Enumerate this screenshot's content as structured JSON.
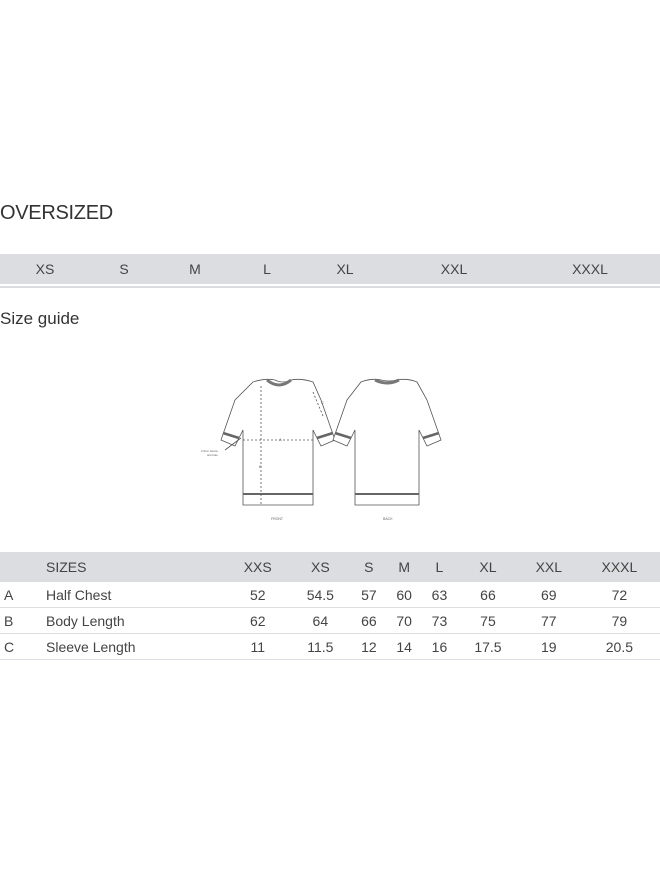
{
  "title": "OVERSIZED",
  "size_bar": [
    "XS",
    "S",
    "M",
    "L",
    "XL",
    "XXL",
    "XXXL"
  ],
  "guide_title": "Size guide",
  "diagram": {
    "front_label": "FRONT",
    "back_label": "BACK",
    "armpit_note_line1": "2.5cm below",
    "armpit_note_line2": "armhole",
    "marker_a": "A",
    "marker_b": "B",
    "marker_c": "C"
  },
  "table": {
    "header_label": "SIZES",
    "columns": [
      "XXS",
      "XS",
      "S",
      "M",
      "L",
      "XL",
      "XXL",
      "XXXL"
    ],
    "rows": [
      {
        "letter": "A",
        "name": "Half Chest",
        "values": [
          "52",
          "54.5",
          "57",
          "60",
          "63",
          "66",
          "69",
          "72"
        ]
      },
      {
        "letter": "B",
        "name": "Body Length",
        "values": [
          "62",
          "64",
          "66",
          "70",
          "73",
          "75",
          "77",
          "79"
        ]
      },
      {
        "letter": "C",
        "name": "Sleeve Length",
        "values": [
          "11",
          "11.5",
          "12",
          "14",
          "16",
          "17.5",
          "19",
          "20.5"
        ]
      }
    ]
  }
}
